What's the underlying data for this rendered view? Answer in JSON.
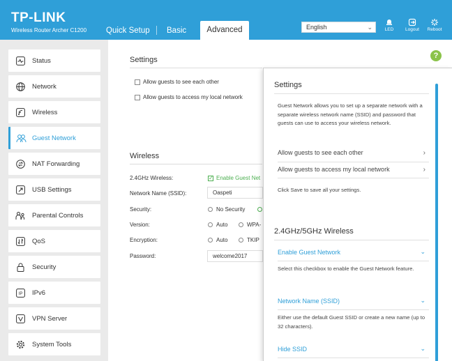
{
  "header": {
    "logo": "TP-LINK",
    "model": "Wireless Router Archer C1200",
    "tabs": [
      {
        "label": "Quick Setup"
      },
      {
        "label": "Basic"
      },
      {
        "label": "Advanced"
      }
    ],
    "language": "English",
    "buttons": {
      "led": "LED",
      "logout": "Logout",
      "reboot": "Reboot"
    }
  },
  "sidebar": {
    "items": [
      {
        "label": "Status",
        "icon": "status-icon"
      },
      {
        "label": "Network",
        "icon": "globe-icon"
      },
      {
        "label": "Wireless",
        "icon": "wireless-icon"
      },
      {
        "label": "Guest Network",
        "icon": "guest-network-icon",
        "active": true
      },
      {
        "label": "NAT Forwarding",
        "icon": "nat-forwarding-icon"
      },
      {
        "label": "USB Settings",
        "icon": "usb-icon"
      },
      {
        "label": "Parental Controls",
        "icon": "parental-controls-icon"
      },
      {
        "label": "QoS",
        "icon": "qos-icon"
      },
      {
        "label": "Security",
        "icon": "lock-icon"
      },
      {
        "label": "IPv6",
        "icon": "ipv6-icon"
      },
      {
        "label": "VPN Server",
        "icon": "vpn-icon"
      },
      {
        "label": "System Tools",
        "icon": "gear-icon"
      }
    ]
  },
  "settings": {
    "title": "Settings",
    "allow_each_other": "Allow guests to see each other",
    "allow_local": "Allow guests to access my local network"
  },
  "wireless": {
    "title": "Wireless",
    "band_label": "2.4GHz Wireless:",
    "enable_label": "Enable Guest Net",
    "ssid_label": "Network Name (SSID):",
    "ssid_value": "Oaspeti",
    "security_label": "Security:",
    "security_options": [
      "No Security"
    ],
    "version_label": "Version:",
    "version_options": [
      "Auto",
      "WPA-"
    ],
    "encryption_label": "Encryption:",
    "encryption_options": [
      "Auto",
      "TKIP"
    ],
    "password_label": "Password:",
    "password_value": "welcome2017"
  },
  "help": {
    "settings_title": "Settings",
    "settings_desc": "Guest Network allows you to set up a separate network with a separate wireless network name (SSID) and password that guests can use to access your wireless network.",
    "items": [
      {
        "label": "Allow guests to see each other"
      },
      {
        "label": "Allow guests to access my local network"
      }
    ],
    "save_note": "Click Save to save all your settings.",
    "wireless_title": "2.4GHz/5GHz Wireless",
    "accordion": [
      {
        "label": "Enable Guest Network",
        "desc": "Select this checkbox to enable the Guest Network feature."
      },
      {
        "label": "Network Name (SSID)",
        "desc": "Either use the default Guest SSID or create a new name (up to 32 characters)."
      },
      {
        "label": "Hide SSID",
        "desc": ""
      }
    ]
  },
  "colors": {
    "brand": "#2f9fd8",
    "sidebar_bg": "#eaeaea",
    "help_green": "#8bc34a",
    "check_green": "#4caf50"
  }
}
